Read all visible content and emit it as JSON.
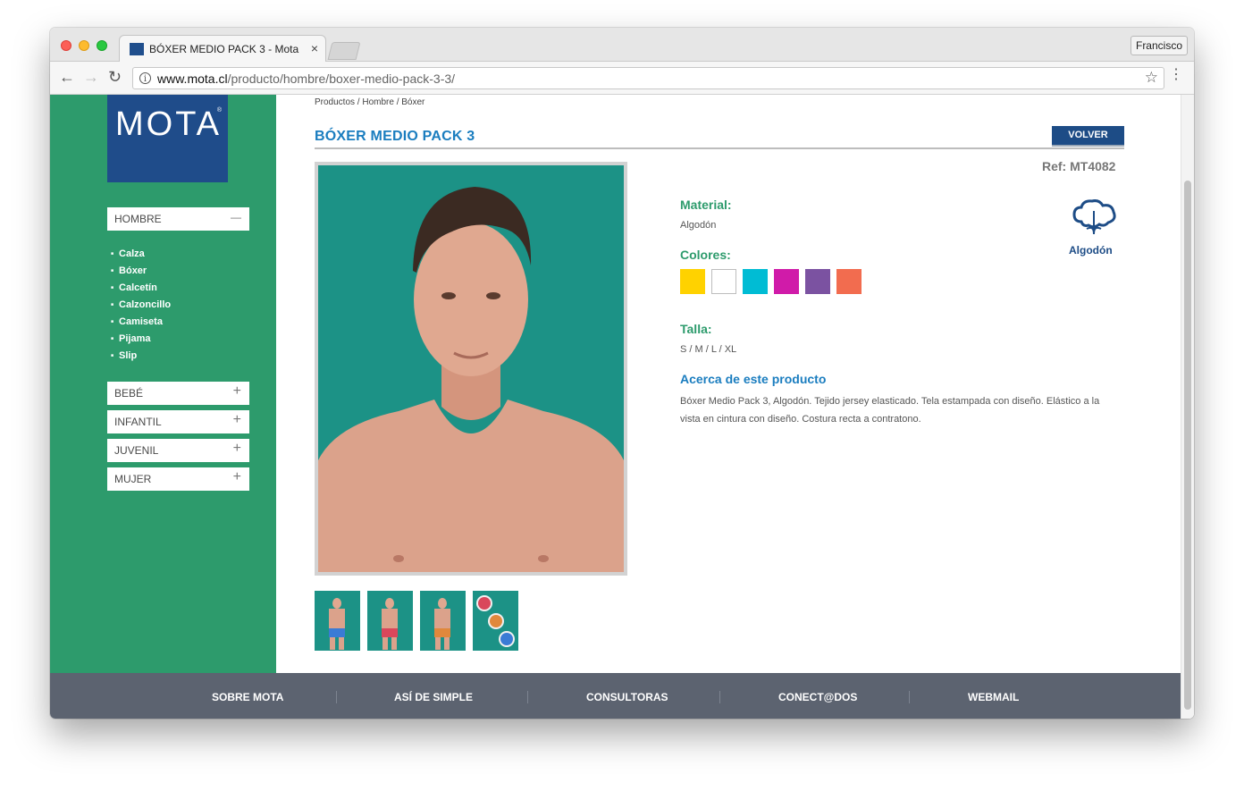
{
  "browser": {
    "tab_title": "BÓXER MEDIO PACK 3 - Mota",
    "tab_close": "×",
    "profile_name": "Francisco",
    "url_host": "www.mota.cl",
    "url_path": "/producto/hombre/boxer-medio-pack-3-3/",
    "back_glyph": "←",
    "forward_glyph": "→",
    "reload_glyph": "↻",
    "info_glyph": "i",
    "star_glyph": "☆",
    "menu_glyph": "⋮"
  },
  "sidebar": {
    "logo_text": "MOTA",
    "logo_reg": "®",
    "open_category": {
      "label": "HOMBRE",
      "toggle": "—"
    },
    "subcategories": [
      "Calza",
      "Bóxer",
      "Calcetín",
      "Calzoncillo",
      "Camiseta",
      "Pijama",
      "Slip"
    ],
    "categories": [
      {
        "label": "BEBÉ",
        "toggle": "+"
      },
      {
        "label": "INFANTIL",
        "toggle": "+"
      },
      {
        "label": "JUVENIL",
        "toggle": "+"
      },
      {
        "label": "MUJER",
        "toggle": "+"
      }
    ]
  },
  "product": {
    "breadcrumb": "Productos / Hombre / Bóxer",
    "title": "BÓXER MEDIO PACK 3",
    "back_button": "VOLVER",
    "ref": "Ref: MT4082",
    "material_label": "Material:",
    "material_value": "Algodón",
    "colors_label": "Colores:",
    "colors": [
      "#ffd200",
      "#ffffff",
      "#00bcd4",
      "#d01ba9",
      "#7b52a1",
      "#f26c4f"
    ],
    "size_label": "Talla:",
    "size_value": "S / M / L / XL",
    "about_title": "Acerca de este producto",
    "about_text": "Bóxer Medio Pack 3, Algodón. Tejido jersey elasticado. Tela estampada con diseño. Elástico a la vista en cintura con diseño. Costura recta a contratono.",
    "badge_label": "Algodón",
    "badge_icon": "cotton-icon"
  },
  "footer": {
    "links": [
      "SOBRE MOTA",
      "ASÍ DE SIMPLE",
      "CONSULTORAS",
      "CONECT@DOS",
      "WEBMAIL"
    ]
  },
  "colors": {
    "sidebar_green": "#2d9b6c",
    "logo_blue": "#1f4c8a",
    "title_blue": "#1a7dbf",
    "footer_gray": "#5c6370",
    "photo_teal": "#1c9286"
  }
}
